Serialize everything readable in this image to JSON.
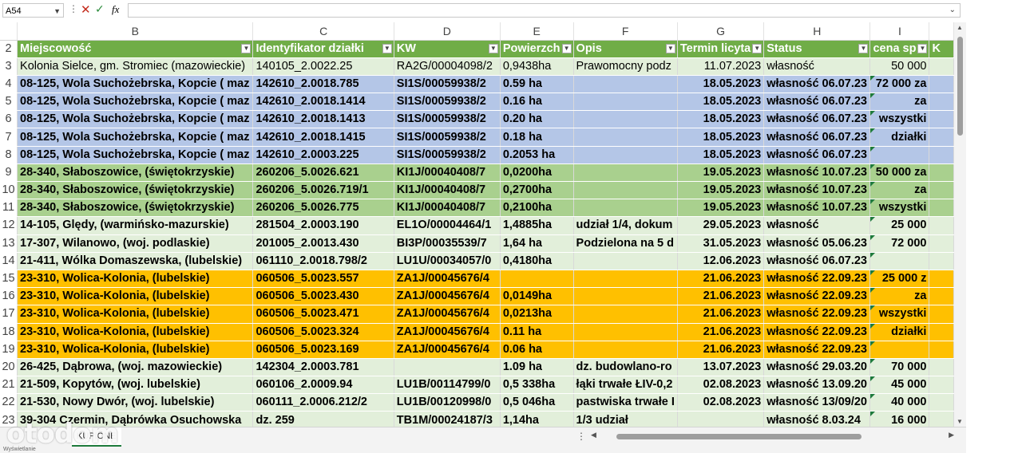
{
  "formula_bar": {
    "name_box": "A54",
    "fx": "fx",
    "formula": ""
  },
  "columns": [
    "B",
    "C",
    "D",
    "E",
    "F",
    "G",
    "H",
    "I"
  ],
  "header_row": {
    "row_num": "2",
    "cells": [
      "Miejscowość",
      "Identyfikator działki",
      "KW",
      "Powierzch",
      "Opis",
      "Termin licyta",
      "Status",
      "cena sp",
      "K"
    ]
  },
  "rows": [
    {
      "n": "3",
      "bg": "#e2efda",
      "bold": false,
      "cells": [
        "Kolonia Sielce, gm. Stromiec (mazowieckie)",
        "140105_2.0022.25",
        "RA2G/00004098/2",
        "0,9438ha",
        "Prawomocny podz",
        "11.07.2023",
        "własność",
        "50 000",
        ""
      ]
    },
    {
      "n": "4",
      "bg": "#b4c6e7",
      "bold": true,
      "cells": [
        "08-125, Wola Suchożebrska, Kopcie ( maz",
        "142610_2.0018.785",
        "SI1S/00059938/2",
        "0.59 ha",
        "",
        "18.05.2023",
        "własność 06.07.23",
        "72 000 za",
        ""
      ]
    },
    {
      "n": "5",
      "bg": "#b4c6e7",
      "bold": true,
      "cells": [
        "08-125, Wola Suchożebrska, Kopcie ( maz",
        "142610_2.0018.1414",
        "SI1S/00059938/2",
        "0.16 ha",
        "",
        "18.05.2023",
        "własność 06.07.23",
        "za",
        ""
      ]
    },
    {
      "n": "6",
      "bg": "#b4c6e7",
      "bold": true,
      "cells": [
        "08-125, Wola Suchożebrska, Kopcie ( maz",
        "142610_2.0018.1413",
        "SI1S/00059938/2",
        "0.20 ha",
        "",
        "18.05.2023",
        "własność 06.07.23",
        "wszystki",
        ""
      ]
    },
    {
      "n": "7",
      "bg": "#b4c6e7",
      "bold": true,
      "cells": [
        "08-125, Wola Suchożebrska, Kopcie ( maz",
        "142610_2.0018.1415",
        "SI1S/00059938/2",
        "0.18 ha",
        "",
        "18.05.2023",
        "własność 06.07.23",
        "działki",
        ""
      ]
    },
    {
      "n": "8",
      "bg": "#b4c6e7",
      "bold": true,
      "cells": [
        "08-125, Wola Suchożebrska, Kopcie ( maz",
        "142610_2.0003.225",
        "SI1S/00059938/2",
        "0.2053 ha",
        "",
        "18.05.2023",
        "własność 06.07.23",
        "",
        ""
      ]
    },
    {
      "n": "9",
      "bg": "#a9d08e",
      "bold": true,
      "cells": [
        "28-340, Słaboszowice, (świętokrzyskie)",
        "260206_5.0026.621",
        "KI1J/00040408/7",
        "0,0200ha",
        "",
        "19.05.2023",
        "własność 10.07.23",
        "50 000 za",
        ""
      ]
    },
    {
      "n": "10",
      "bg": "#a9d08e",
      "bold": true,
      "cells": [
        "28-340, Słaboszowice, (świętokrzyskie)",
        "260206_5.0026.719/1",
        "KI1J/00040408/7",
        "0,2700ha",
        "",
        "19.05.2023",
        "własność 10.07.23",
        "za",
        ""
      ]
    },
    {
      "n": "11",
      "bg": "#a9d08e",
      "bold": true,
      "cells": [
        "28-340, Słaboszowice, (świętokrzyskie)",
        "260206_5.0026.775",
        "KI1J/00040408/7",
        "0,2100ha",
        "",
        "19.05.2023",
        "własność 10.07.23",
        "wszystki",
        ""
      ]
    },
    {
      "n": "12",
      "bg": "#e2efda",
      "bold": true,
      "cells": [
        "14-105, Ględy, (warmińsko-mazurskie)",
        "281504_2.0003.190",
        "EL1O/00004464/1",
        "1,4885ha",
        "udział 1/4, dokum",
        "29.05.2023",
        "własność",
        "25 000",
        ""
      ]
    },
    {
      "n": "13",
      "bg": "#e2efda",
      "bold": true,
      "cells": [
        "17-307, Wilanowo, (woj. podlaskie)",
        "201005_2.0013.430",
        "BI3P/00035539/7",
        "1,64 ha",
        "Podzielona na 5 d",
        "31.05.2023",
        "własność 05.06.23",
        "72 000",
        ""
      ]
    },
    {
      "n": "14",
      "bg": "#e2efda",
      "bold": true,
      "cells": [
        "21-411, Wólka Domaszewska, (lubelskie)",
        "061110_2.0018.798/2",
        "LU1U/00034057/0",
        "0,4180ha",
        "",
        "12.06.2023",
        "własność 06.07.23",
        "",
        ""
      ]
    },
    {
      "n": "15",
      "bg": "#ffc000",
      "bold": true,
      "cells": [
        "23-310, Wolica-Kolonia, (lubelskie)",
        "060506_5.0023.557",
        "ZA1J/00045676/4",
        "",
        "",
        "21.06.2023",
        "własność 22.09.23",
        "25 000  z",
        ""
      ]
    },
    {
      "n": "16",
      "bg": "#ffc000",
      "bold": true,
      "cells": [
        "23-310, Wolica-Kolonia, (lubelskie)",
        "060506_5.0023.430",
        "ZA1J/00045676/4",
        "0,0149ha",
        "",
        "21.06.2023",
        "własność 22.09.23",
        "za",
        ""
      ]
    },
    {
      "n": "17",
      "bg": "#ffc000",
      "bold": true,
      "cells": [
        "23-310, Wolica-Kolonia, (lubelskie)",
        "060506_5.0023.471",
        "ZA1J/00045676/4",
        "0,0213ha",
        "",
        "21.06.2023",
        "własność 22.09.23",
        "wszystki",
        ""
      ]
    },
    {
      "n": "18",
      "bg": "#ffc000",
      "bold": true,
      "cells": [
        "23-310, Wolica-Kolonia, (lubelskie)",
        "060506_5.0023.324",
        "ZA1J/00045676/4",
        "0.11 ha",
        "",
        "21.06.2023",
        "własność 22.09.23",
        "działki",
        ""
      ]
    },
    {
      "n": "19",
      "bg": "#ffc000",
      "bold": true,
      "cells": [
        "23-310, Wolica-Kolonia, (lubelskie)",
        "060506_5.0023.169",
        "ZA1J/00045676/4",
        "0.06 ha",
        "",
        "21.06.2023",
        "własność 22.09.23",
        "",
        ""
      ]
    },
    {
      "n": "20",
      "bg": "#e2efda",
      "bold": true,
      "cells": [
        "26-425, Dąbrowa, (woj. mazowieckie)",
        "142304_2.0003.781",
        "",
        "1.09 ha",
        "dz. budowlano-ro",
        "13.07.2023",
        "własność 29.03.20",
        "70 000",
        ""
      ]
    },
    {
      "n": "21",
      "bg": "#e2efda",
      "bold": true,
      "cells": [
        "21-509, Kopytów, (woj. lubelskie)",
        "060106_2.0009.94",
        "LU1B/00114799/0",
        "0,5 338ha",
        "łąki trwałe ŁIV-0,2",
        "02.08.2023",
        "własność 13.09.20",
        "45 000",
        ""
      ]
    },
    {
      "n": "22",
      "bg": "#e2efda",
      "bold": true,
      "cells": [
        "21-530, Nowy Dwór, (woj. lubelskie)",
        "060111_2.0006.212/2",
        "LU1B/00120998/0",
        "0,5 046ha",
        "pastwiska trwałe I",
        "02.08.2023",
        "własność 13/09/20",
        "40 000",
        ""
      ]
    },
    {
      "n": "23",
      "bg": "#e2efda",
      "bold": true,
      "cells": [
        "39-304 Czermin, Dąbrówka Osuchowska",
        "dz. 259",
        "TB1M/00024187/3",
        "1,14ha",
        "1/3 udział",
        "",
        "własność 8.03.24",
        "16 000",
        ""
      ]
    }
  ],
  "sheet_tab": "KUPIONE",
  "watermark": "otodom",
  "status_text": "Wyświetlanie"
}
